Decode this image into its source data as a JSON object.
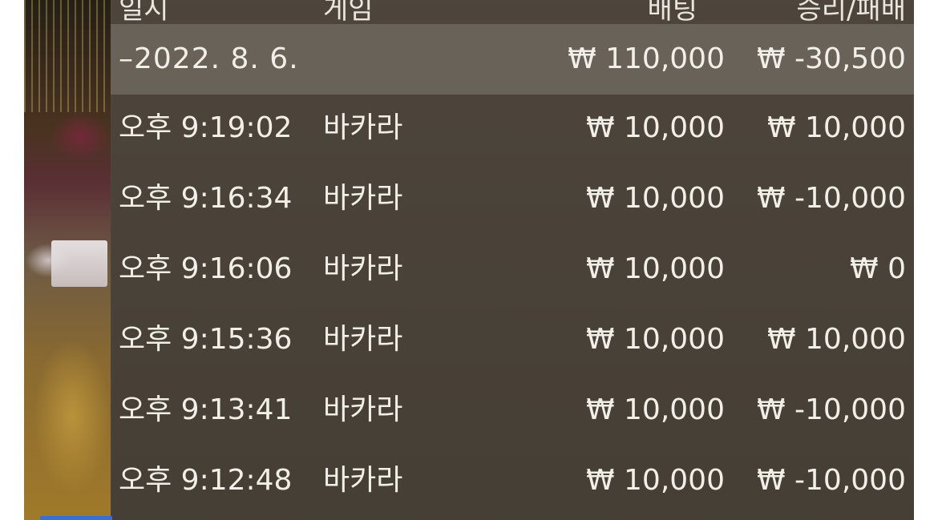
{
  "header": {
    "col_time": "일시",
    "col_game": "게임",
    "col_bet": "배팅",
    "col_result": "승리/패배"
  },
  "summary": {
    "date": "–2022. 8. 6.",
    "bet": "₩ 110,000",
    "result": "₩ -30,500"
  },
  "rows": [
    {
      "time": "오후 9:19:02",
      "game": "바카라",
      "bet": "₩ 10,000",
      "result": "₩ 10,000"
    },
    {
      "time": "오후 9:16:34",
      "game": "바카라",
      "bet": "₩ 10,000",
      "result": "₩ -10,000"
    },
    {
      "time": "오후 9:16:06",
      "game": "바카라",
      "bet": "₩ 10,000",
      "result": "₩ 0"
    },
    {
      "time": "오후 9:15:36",
      "game": "바카라",
      "bet": "₩ 10,000",
      "result": "₩ 10,000"
    },
    {
      "time": "오후 9:13:41",
      "game": "바카라",
      "bet": "₩ 10,000",
      "result": "₩ -10,000"
    },
    {
      "time": "오후 9:12:48",
      "game": "바카라",
      "bet": "₩ 10,000",
      "result": "₩ -10,000"
    }
  ],
  "colors": {
    "panel": "#4a4238",
    "summary_row": "#736c64",
    "text": "#f2efe9"
  }
}
